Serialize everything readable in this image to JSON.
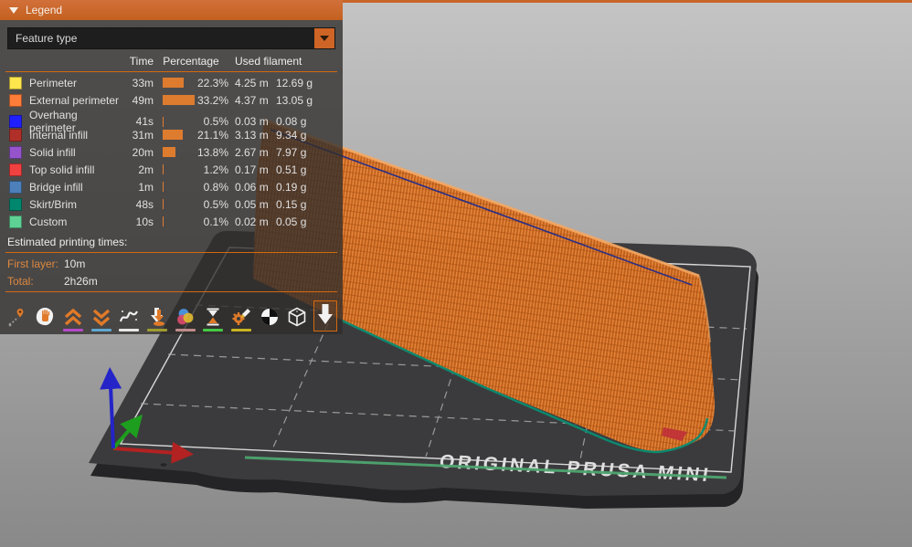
{
  "legend": {
    "title": "Legend",
    "view_type": "Feature type"
  },
  "table": {
    "columns": [
      "Time",
      "Percentage",
      "Used filament"
    ],
    "rows": [
      {
        "feature": "Perimeter",
        "color": "#FFE64D",
        "time": "33m",
        "percent": 22.3,
        "percent_label": "22.3%",
        "filament_m": "4.25 m",
        "filament_g": "12.69 g"
      },
      {
        "feature": "External perimeter",
        "color": "#FF7D38",
        "time": "49m",
        "percent": 33.2,
        "percent_label": "33.2%",
        "filament_m": "4.37 m",
        "filament_g": "13.05 g"
      },
      {
        "feature": "Overhang perimeter",
        "color": "#1F1FFF",
        "time": "41s",
        "percent": 0.5,
        "percent_label": "0.5%",
        "filament_m": "0.03 m",
        "filament_g": "0.08 g"
      },
      {
        "feature": "Internal infill",
        "color": "#B03029",
        "time": "31m",
        "percent": 21.1,
        "percent_label": "21.1%",
        "filament_m": "3.13 m",
        "filament_g": "9.34 g"
      },
      {
        "feature": "Solid infill",
        "color": "#9654CC",
        "time": "20m",
        "percent": 13.8,
        "percent_label": "13.8%",
        "filament_m": "2.67 m",
        "filament_g": "7.97 g"
      },
      {
        "feature": "Top solid infill",
        "color": "#F04040",
        "time": "2m",
        "percent": 1.2,
        "percent_label": "1.2%",
        "filament_m": "0.17 m",
        "filament_g": "0.51 g"
      },
      {
        "feature": "Bridge infill",
        "color": "#4D80BA",
        "time": "1m",
        "percent": 0.8,
        "percent_label": "0.8%",
        "filament_m": "0.06 m",
        "filament_g": "0.19 g"
      },
      {
        "feature": "Skirt/Brim",
        "color": "#00876E",
        "time": "48s",
        "percent": 0.5,
        "percent_label": "0.5%",
        "filament_m": "0.05 m",
        "filament_g": "0.15 g"
      },
      {
        "feature": "Custom",
        "color": "#5ED194",
        "time": "10s",
        "percent": 0.1,
        "percent_label": "0.1%",
        "filament_m": "0.02 m",
        "filament_g": "0.05 g"
      }
    ]
  },
  "times": {
    "section_title": "Estimated printing times:",
    "first_layer_label": "First layer:",
    "first_layer_value": "10m",
    "total_label": "Total:",
    "total_value": "2h26m"
  },
  "toolbar": {
    "icons": [
      "travel-icon",
      "wipe-icon",
      "retractions-icon",
      "deretractions-icon",
      "seams-icon",
      "tool-changes-icon",
      "color-changes-icon",
      "pause-prints-icon",
      "custom-gcode-icon",
      "shells-icon",
      "preview-box-icon",
      "tool-marker-icon"
    ],
    "selected": "tool-marker-icon"
  },
  "viewport": {
    "bed_label": "ORIGINAL PRUSA MINI"
  },
  "colors": {
    "accent_orange": "#D4690F",
    "bar_orange": "#DD7B2E",
    "model_orange": "#D2691E",
    "skirt_teal": "#0B8C72",
    "custom_green": "#4EA56F",
    "seam_blue": "#1E2A8C",
    "axis_x": "#B22222",
    "axis_y": "#1E9E1E",
    "axis_z": "#2424C8"
  }
}
